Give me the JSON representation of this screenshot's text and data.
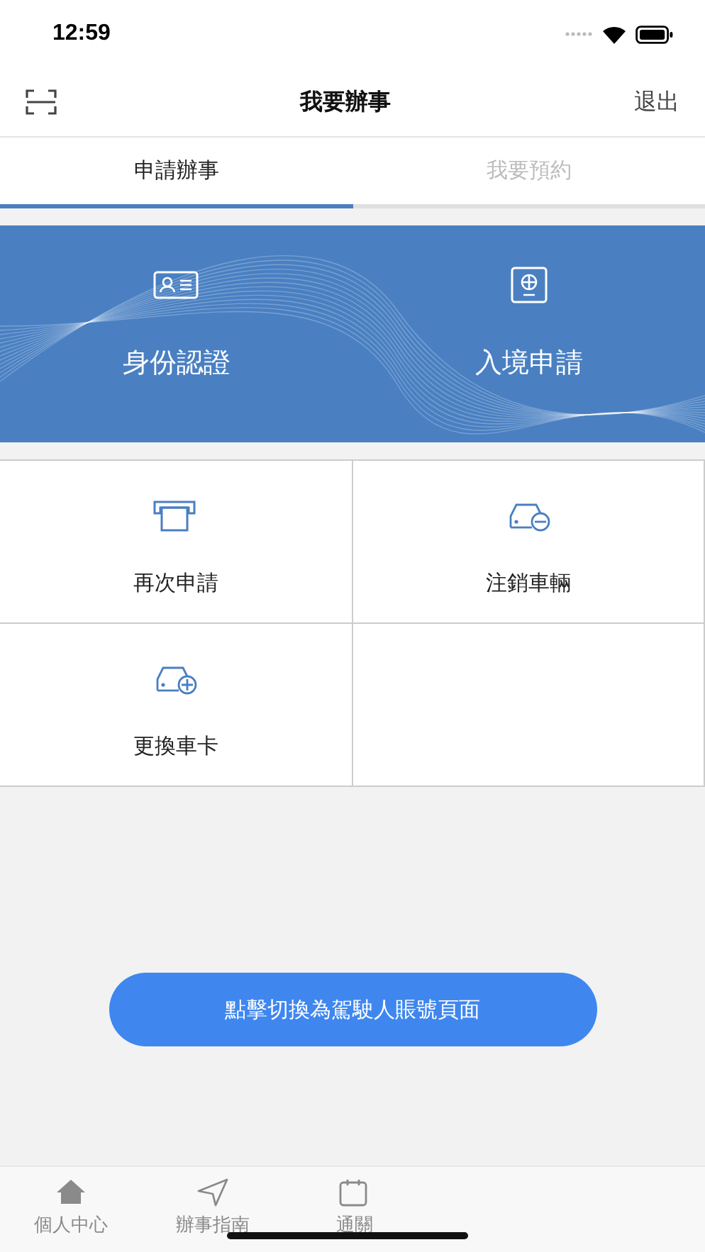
{
  "status_bar": {
    "time": "12:59"
  },
  "nav": {
    "title": "我要辦事",
    "action": "退出"
  },
  "tabs": [
    {
      "label": "申請辦事",
      "selected": true
    },
    {
      "label": "我要預約",
      "selected": false
    }
  ],
  "banner": [
    {
      "label": "身份認證"
    },
    {
      "label": "入境申請"
    }
  ],
  "services": [
    {
      "label": "再次申請"
    },
    {
      "label": "注銷車輛"
    },
    {
      "label": "更換車卡"
    }
  ],
  "switch_button": "點擊切換為駕駛人賬號頁面",
  "bottom_tabs": [
    {
      "label": "個人中心"
    },
    {
      "label": "辦事指南"
    },
    {
      "label": "通關"
    }
  ]
}
